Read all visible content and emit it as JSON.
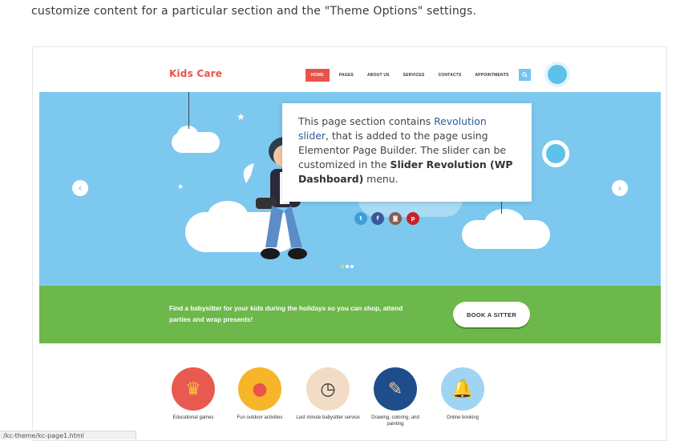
{
  "intro": "customize content for a particular section and the \"Theme Options\" settings.",
  "site": {
    "logo": "Kids Care",
    "nav": [
      "HOME",
      "PAGES",
      "ABOUT US",
      "SERVICES",
      "CONTACTS",
      "APPOINTMENTS"
    ],
    "active_nav": "HOME",
    "search_icon": "search-icon"
  },
  "hero": {
    "prev_icon": "chevron-left-icon",
    "next_icon": "chevron-right-icon",
    "social": [
      {
        "icon": "twitter-icon",
        "glyph": "t",
        "color": "#3d9fd8"
      },
      {
        "icon": "facebook-icon",
        "glyph": "f",
        "color": "#3b5998"
      },
      {
        "icon": "instagram-icon",
        "glyph": "◙",
        "color": "#8a5a50"
      },
      {
        "icon": "pinterest-icon",
        "glyph": "p",
        "color": "#cb2027"
      }
    ],
    "slide_count": 3,
    "active_slide": 1
  },
  "tooltip": {
    "part1": "This page section contains ",
    "link": "Revolution slider",
    "part2": ", that is added to the page using Elementor Page Builder. The slider can be customized in the ",
    "strong": "Slider Revolution (WP Dashboard)",
    "part3": " menu."
  },
  "cta": {
    "text": "Find a babysitter for your kids during the holidays so you can shop, attend parties and wrap presents!",
    "button": "BOOK A SITTER"
  },
  "features": [
    {
      "label": "Educational games",
      "icon": "crown-icon",
      "glyph": "♛",
      "color": "#e85a50",
      "glyph_color": "#f6c43a"
    },
    {
      "label": "Fun outdoor activities",
      "icon": "balloon-icon",
      "glyph": "●",
      "color": "#f7b52a",
      "glyph_color": "#e8534a"
    },
    {
      "label": "Last minute babysitter service",
      "icon": "clock-icon",
      "glyph": "◷",
      "color": "#f3dcc5",
      "glyph_color": "#333333"
    },
    {
      "label": "Drawing, coloring, and painting",
      "icon": "paintbrush-icon",
      "glyph": "✎",
      "color": "#1f4d8c",
      "glyph_color": "#f0c89a"
    },
    {
      "label": "Online booking",
      "icon": "bell-icon",
      "glyph": "🔔",
      "color": "#9fd4f2",
      "glyph_color": "#f5b83a"
    }
  ],
  "status_bar": "/kc-theme/kc-page1.html"
}
